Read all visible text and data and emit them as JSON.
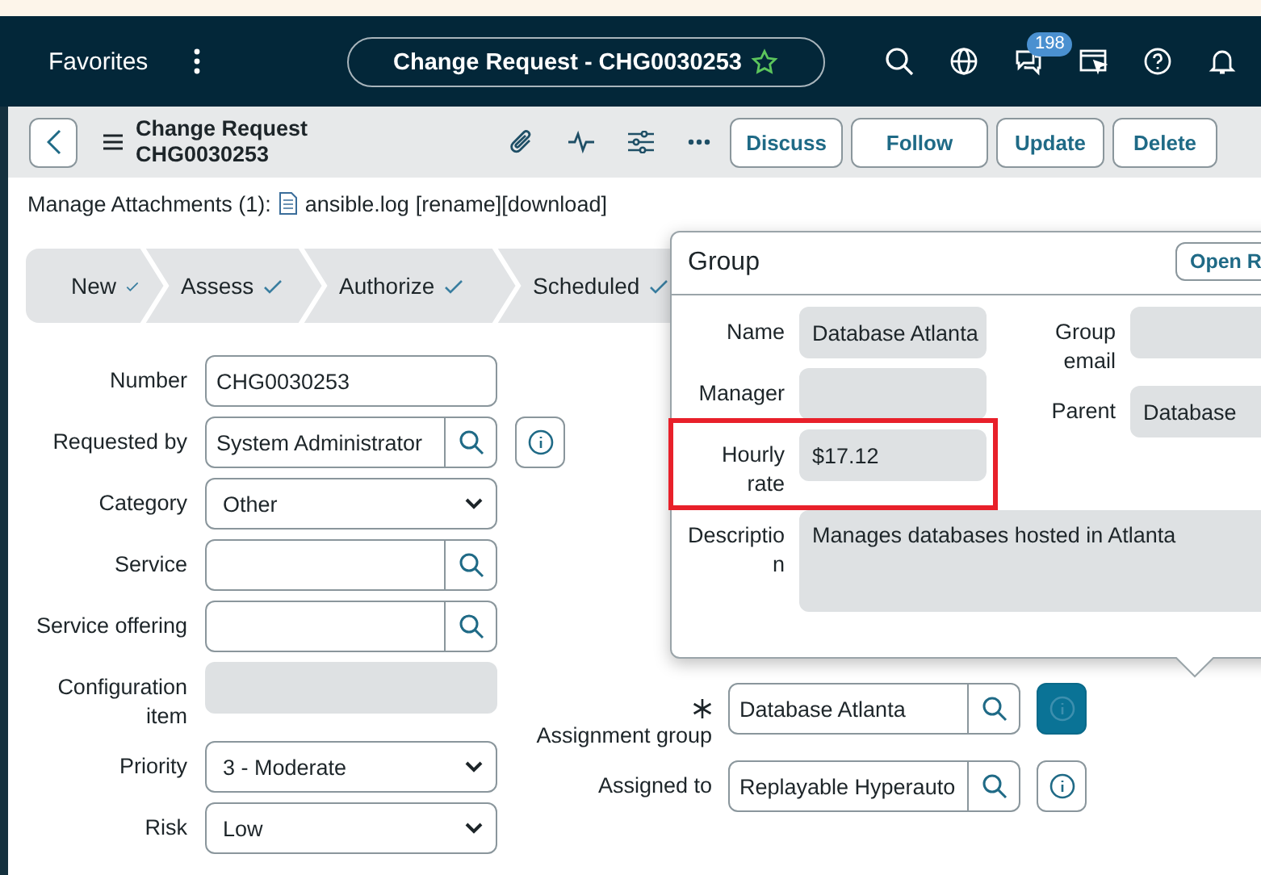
{
  "nav": {
    "title": "Favorites",
    "record": "Change Request - CHG0030253",
    "chat_badge": "198"
  },
  "header": {
    "title": "Change Request",
    "number": "CHG0030253",
    "buttons": [
      "Discuss",
      "Follow",
      "Update",
      "Delete"
    ]
  },
  "attachments": {
    "label": "Manage Attachments (1):",
    "file": "ansible.log",
    "actions": [
      "[rename]",
      "[download]"
    ]
  },
  "stages": [
    {
      "label": "New",
      "done": true
    },
    {
      "label": "Assess",
      "done": true
    },
    {
      "label": "Authorize",
      "done": true
    },
    {
      "label": "Scheduled",
      "done": true
    }
  ],
  "form": {
    "left": [
      {
        "label": "Number",
        "kind": "text",
        "value": "CHG0030253"
      },
      {
        "label": "Requested by",
        "kind": "lookup",
        "value": "System Administrator",
        "active": false
      },
      {
        "label": "Category",
        "kind": "select",
        "value": "Other"
      },
      {
        "label": "Service",
        "kind": "lookup"
      },
      {
        "label": "Service offering",
        "kind": "lookup"
      },
      {
        "label": "Configuration item",
        "kind": "readonly"
      },
      {
        "label": "Priority",
        "kind": "select",
        "value": "3 - Moderate"
      },
      {
        "label": "Risk",
        "kind": "select",
        "value": "Low"
      }
    ],
    "right": [
      {
        "label": "Assignment group",
        "kind": "lookup",
        "mandatory": true,
        "value": "Database Atlanta",
        "active": true
      },
      {
        "label": "Assigned to",
        "kind": "lookup",
        "value": "Replayable Hyperauto",
        "active": false
      }
    ]
  },
  "popup": {
    "title": "Group",
    "button": "Open R",
    "left": [
      {
        "label": "Name",
        "value": "Database Atlanta"
      },
      {
        "label": "Manager"
      },
      {
        "label": "Hourly rate",
        "value": "$17.12",
        "highlighted": true
      }
    ],
    "right": [
      {
        "label": "Group email"
      },
      {
        "label": "Parent",
        "value": "Database"
      }
    ],
    "description": {
      "label": "Description",
      "value": "Manages databases hosted in Atlanta"
    }
  }
}
